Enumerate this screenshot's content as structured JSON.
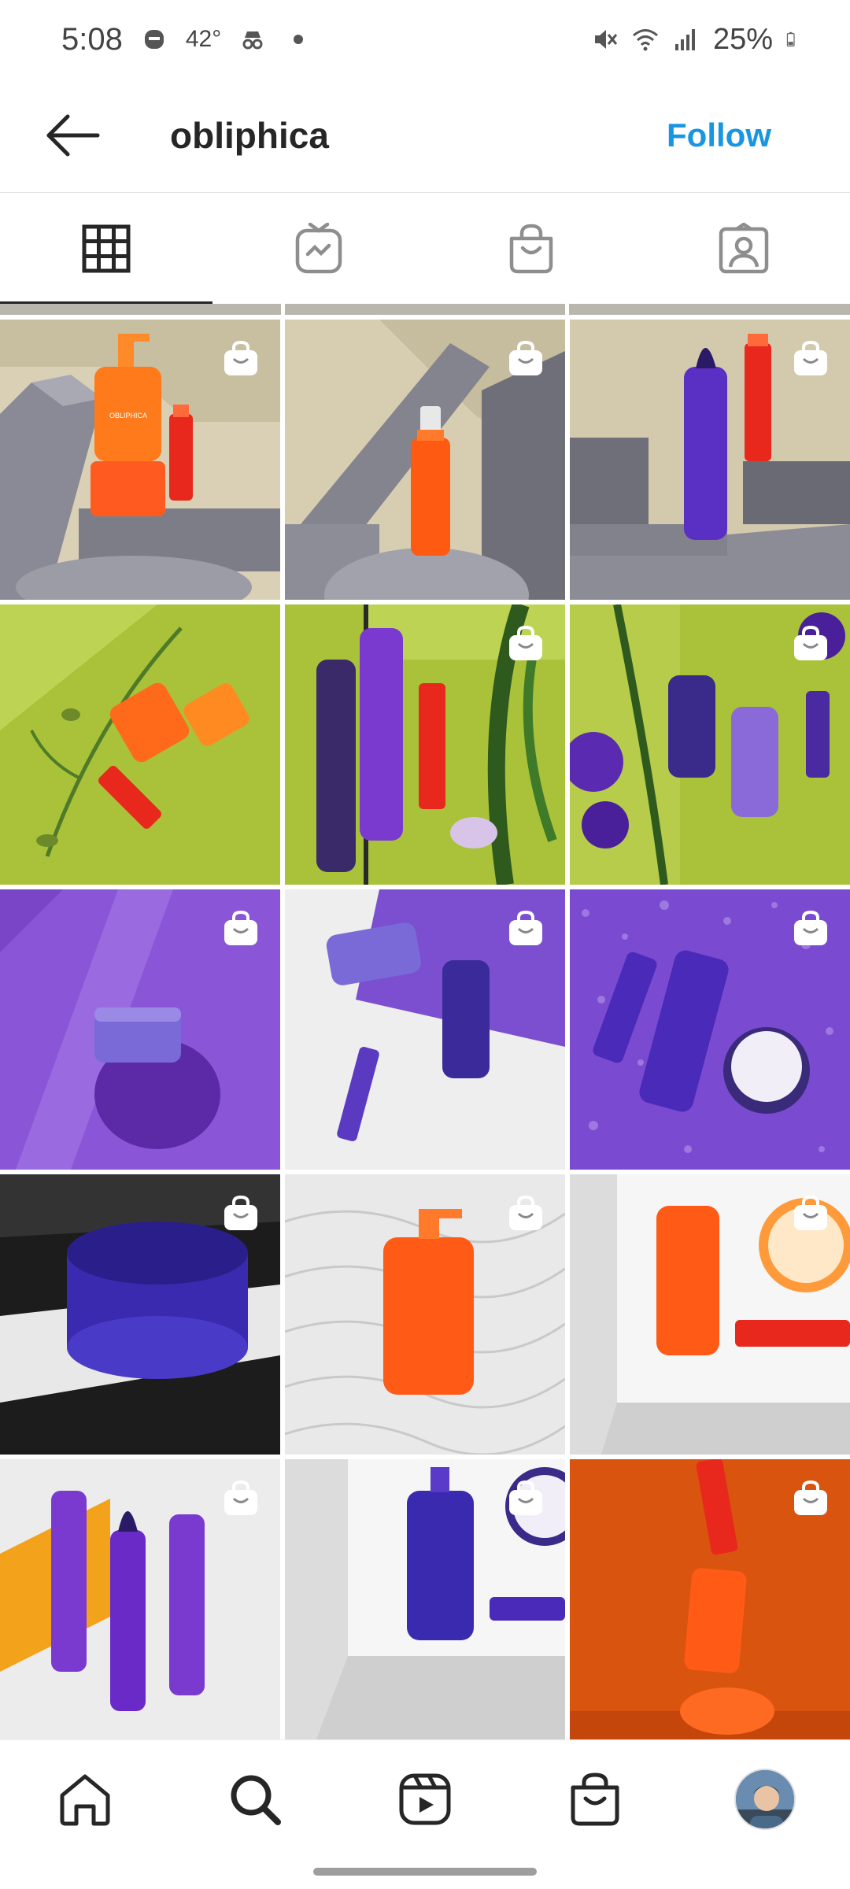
{
  "status_bar": {
    "time": "5:08",
    "temperature": "42°",
    "battery": "25%",
    "icons": [
      "notification-icon",
      "incognito-icon",
      "dot-icon",
      "mute-icon",
      "wifi-icon",
      "signal-icon",
      "battery-icon"
    ]
  },
  "header": {
    "username": "obliphica",
    "follow_label": "Follow",
    "follow_color": "#1a95e0"
  },
  "tabs": [
    {
      "name": "grid",
      "icon": "grid-icon",
      "active": true
    },
    {
      "name": "igtv",
      "icon": "igtv-icon",
      "active": false
    },
    {
      "name": "shop",
      "icon": "shopping-bag-icon",
      "active": false
    },
    {
      "name": "tagged",
      "icon": "tagged-person-icon",
      "active": false
    }
  ],
  "posts": [
    {
      "description": "orange products on gray blocks",
      "shoppable": true
    },
    {
      "description": "orange serum on gray blocks",
      "shoppable": true
    },
    {
      "description": "purple mousse on gray blocks",
      "shoppable": true
    },
    {
      "description": "orange products on green with flowers",
      "shoppable": false
    },
    {
      "description": "purple sprays on green with leaves",
      "shoppable": true
    },
    {
      "description": "purple bottles with violet flowers",
      "shoppable": true
    },
    {
      "description": "purple hair mask jar",
      "shoppable": true
    },
    {
      "description": "purple products on white and purple",
      "shoppable": true
    },
    {
      "description": "purple products with water drops",
      "shoppable": true
    },
    {
      "description": "purple hair mask on black",
      "shoppable": true
    },
    {
      "description": "orange shampoo on white texture",
      "shoppable": true
    },
    {
      "description": "orange products on white tray",
      "shoppable": true
    },
    {
      "description": "purple sprays on orange and white",
      "shoppable": true
    },
    {
      "description": "purple shampoo on white tray",
      "shoppable": true
    },
    {
      "description": "orange bottles stacked on orange",
      "shoppable": true
    }
  ],
  "bottom_nav": [
    {
      "name": "home",
      "icon": "home-icon"
    },
    {
      "name": "search",
      "icon": "search-icon"
    },
    {
      "name": "reels",
      "icon": "reels-icon"
    },
    {
      "name": "shop",
      "icon": "shopping-bag-icon"
    },
    {
      "name": "profile",
      "icon": "avatar"
    }
  ],
  "product_text": {
    "brand": "OBLIPHICA"
  }
}
